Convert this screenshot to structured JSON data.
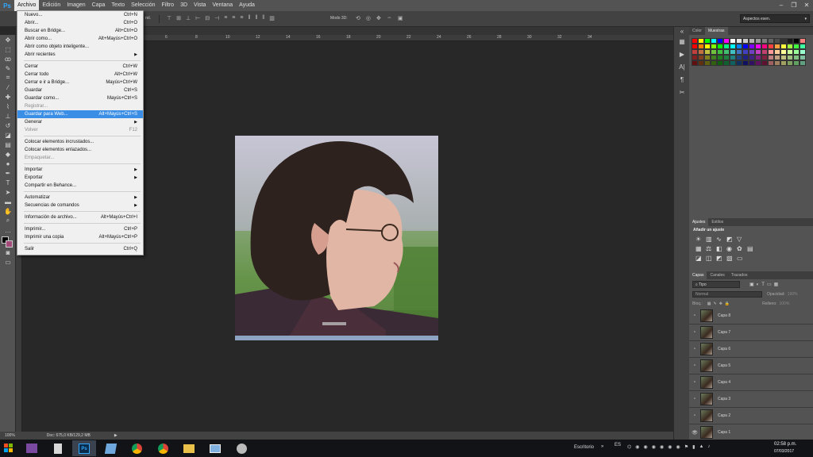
{
  "app": {
    "logo": "Ps"
  },
  "menubar": {
    "items": [
      "Archivo",
      "Edición",
      "Imagen",
      "Capa",
      "Texto",
      "Selección",
      "Filtro",
      "3D",
      "Vista",
      "Ventana",
      "Ayuda"
    ]
  },
  "options_bar": {
    "mode_label": "Modo 3D:",
    "workspace": "Aspectos esen.",
    "partial_label": "rol."
  },
  "ruler_ticks": [
    "6",
    "8",
    "10",
    "12",
    "14",
    "16",
    "18",
    "20",
    "22",
    "24",
    "26",
    "28",
    "30",
    "32",
    "34"
  ],
  "file_menu": {
    "items": [
      {
        "label": "Nuevo...",
        "shortcut": "Ctrl+N"
      },
      {
        "label": "Abrir...",
        "shortcut": "Ctrl+O"
      },
      {
        "label": "Buscar en Bridge...",
        "shortcut": "Alt+Ctrl+O"
      },
      {
        "label": "Abrir como...",
        "shortcut": "Alt+Mayús+Ctrl+O"
      },
      {
        "label": "Abrir como objeto inteligente...",
        "shortcut": ""
      },
      {
        "label": "Abrir recientes",
        "shortcut": "",
        "submenu": true
      },
      {
        "separator": true
      },
      {
        "label": "Cerrar",
        "shortcut": "Ctrl+W"
      },
      {
        "label": "Cerrar todo",
        "shortcut": "Alt+Ctrl+W"
      },
      {
        "label": "Cerrar e ir a Bridge...",
        "shortcut": "Mayús+Ctrl+W"
      },
      {
        "label": "Guardar",
        "shortcut": "Ctrl+S"
      },
      {
        "label": "Guardar como...",
        "shortcut": "Mayús+Ctrl+S"
      },
      {
        "label": "Registrar...",
        "shortcut": "",
        "disabled": true
      },
      {
        "label": "Guardar para Web...",
        "shortcut": "Alt+Mayús+Ctrl+S",
        "highlighted": true
      },
      {
        "label": "Generar",
        "shortcut": "",
        "submenu": true
      },
      {
        "label": "Volver",
        "shortcut": "F12",
        "disabled": true
      },
      {
        "separator": true
      },
      {
        "label": "Colocar elementos incrustados...",
        "shortcut": ""
      },
      {
        "label": "Colocar elementos enlazados...",
        "shortcut": ""
      },
      {
        "label": "Empaquetar...",
        "shortcut": "",
        "disabled": true
      },
      {
        "separator": true
      },
      {
        "label": "Importar",
        "shortcut": "",
        "submenu": true
      },
      {
        "label": "Exportar",
        "shortcut": "",
        "submenu": true
      },
      {
        "label": "Compartir en Behance...",
        "shortcut": ""
      },
      {
        "separator": true
      },
      {
        "label": "Automatizar",
        "shortcut": "",
        "submenu": true
      },
      {
        "label": "Secuencias de comandos",
        "shortcut": "",
        "submenu": true
      },
      {
        "separator": true
      },
      {
        "label": "Información de archivo...",
        "shortcut": "Alt+Mayús+Ctrl+I"
      },
      {
        "separator": true
      },
      {
        "label": "Imprimir...",
        "shortcut": "Ctrl+P"
      },
      {
        "label": "Imprimir una copia",
        "shortcut": "Alt+Mayús+Ctrl+P"
      },
      {
        "separator": true
      },
      {
        "label": "Salir",
        "shortcut": "Ctrl+Q"
      }
    ]
  },
  "status": {
    "zoom": "100%",
    "doc": "Doc: 675,0 KB/129,2 MB"
  },
  "color_panel": {
    "tabs": [
      "Color",
      "Muestras"
    ],
    "active": "Muestras"
  },
  "adjustments_panel": {
    "tabs": [
      "Ajustes",
      "Estilos"
    ],
    "title": "Añadir un ajuste"
  },
  "layers_panel": {
    "tabs": [
      "Capas",
      "Canales",
      "Trazados"
    ],
    "filter_kind": "Tipo",
    "blend_mode": "Normal",
    "opacity_label": "Opacidad:",
    "opacity_value": "100%",
    "lock_label": "Bloq.:",
    "fill_label": "Relleno:",
    "fill_value": "100%",
    "layers": [
      "Capa 8",
      "Capa 7",
      "Capa 6",
      "Capa 5",
      "Capa 4",
      "Capa 3",
      "Capa 2",
      "Capa 1"
    ]
  },
  "taskbar": {
    "desktop_label": "Escritorio",
    "language": "ES",
    "time": "02:58 p.m.",
    "date": "07/03/2017"
  },
  "colors": {
    "swatch_rows": [
      [
        "#ff0000",
        "#ffff00",
        "#00ff00",
        "#00ffff",
        "#0000ff",
        "#ff00ff",
        "#ffffff",
        "#e6e6e6",
        "#cccccc",
        "#b3b3b3",
        "#999999",
        "#808080",
        "#666666",
        "#4d4d4d",
        "#333333",
        "#1a1a1a",
        "#000000",
        "#ff8080"
      ],
      [
        "#ff0000",
        "#ff8000",
        "#ffff00",
        "#80ff00",
        "#00ff00",
        "#00ff80",
        "#00ffff",
        "#0080ff",
        "#0000ff",
        "#8000ff",
        "#ff00ff",
        "#ff0080",
        "#ff4040",
        "#ffa040",
        "#ffff40",
        "#a0ff40",
        "#40ff40",
        "#40ffa0"
      ],
      [
        "#c04040",
        "#c07040",
        "#c0c040",
        "#70c040",
        "#40c040",
        "#40c070",
        "#40c0c0",
        "#4070c0",
        "#4040c0",
        "#7040c0",
        "#c040c0",
        "#c04070",
        "#ff9999",
        "#ffcc99",
        "#ffff99",
        "#ccff99",
        "#99ff99",
        "#99ffcc"
      ],
      [
        "#802020",
        "#804020",
        "#808020",
        "#408020",
        "#208020",
        "#208040",
        "#208080",
        "#204080",
        "#202080",
        "#402080",
        "#802080",
        "#802040",
        "#c08080",
        "#c0a080",
        "#c0c080",
        "#a0c080",
        "#80c080",
        "#80c0a0"
      ],
      [
        "#601010",
        "#603010",
        "#606010",
        "#306010",
        "#106010",
        "#106030",
        "#106060",
        "#103060",
        "#101060",
        "#301060",
        "#601060",
        "#601030",
        "#a06060",
        "#a08060",
        "#a0a060",
        "#80a060",
        "#60a060",
        "#60a080"
      ]
    ]
  }
}
